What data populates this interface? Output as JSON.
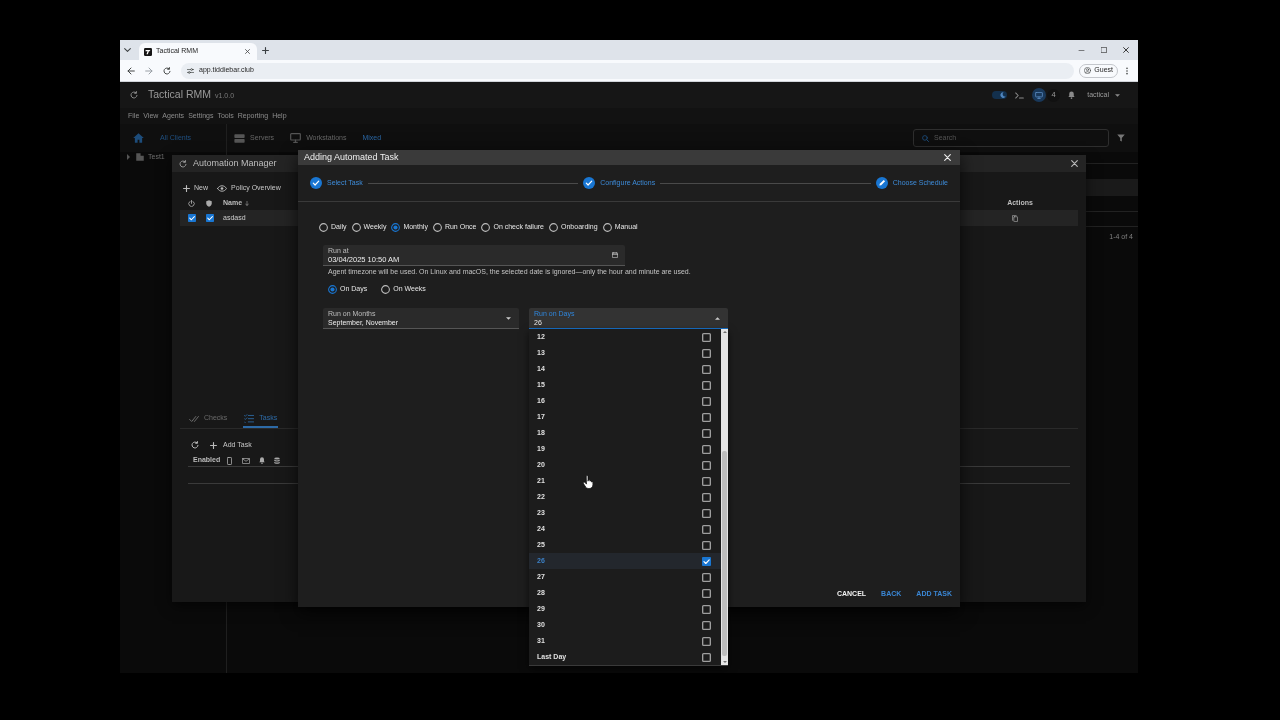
{
  "browser": {
    "tab": {
      "title": "Tactical RMM"
    },
    "url": "app.tiddiebar.club",
    "profile": "Guest"
  },
  "app": {
    "title": "Tactical RMM",
    "version": "v1.0.0",
    "theme_toggle": {
      "on": true
    },
    "agent_count": "4",
    "user": "tactical",
    "menu": [
      "File",
      "View",
      "Agents",
      "Settings",
      "Tools",
      "Reporting",
      "Help"
    ],
    "clients_tab": "All Clients",
    "agent_tabs": [
      {
        "label": "Servers",
        "kind": "server",
        "selected": false
      },
      {
        "label": "Workstations",
        "kind": "workstation",
        "selected": false
      },
      {
        "label": "Mixed",
        "kind": "mixed",
        "selected": true
      }
    ],
    "search": {
      "placeholder": "Search"
    },
    "tree": [
      {
        "label": "Test1",
        "expanded": false
      }
    ],
    "pagination": "1-4 of 4"
  },
  "automation_manager": {
    "title": "Automation Manager",
    "toolbar": [
      {
        "label": "New",
        "kind": "new"
      },
      {
        "label": "Policy Overview",
        "kind": "overview"
      }
    ],
    "columns": {
      "name": "Name",
      "actions": "Actions"
    },
    "policies": [
      {
        "enabled": true,
        "enforced": true,
        "name": "asdasd",
        "selected": true
      }
    ],
    "tabs": [
      {
        "label": "Checks",
        "kind": "checks",
        "selected": false
      },
      {
        "label": "Tasks",
        "kind": "tasks",
        "selected": true
      }
    ],
    "tasks": {
      "add_button": "Add Task",
      "enabled_column": "Enabled"
    }
  },
  "task_dialog": {
    "title": "Adding Automated Task",
    "steps": [
      {
        "label": "Select Task",
        "kind": "done"
      },
      {
        "label": "Configure Actions",
        "kind": "done"
      },
      {
        "label": "Choose Schedule",
        "kind": "edit"
      }
    ],
    "schedule_types": [
      {
        "label": "Daily",
        "selected": false
      },
      {
        "label": "Weekly",
        "selected": false
      },
      {
        "label": "Monthly",
        "selected": true
      },
      {
        "label": "Run Once",
        "selected": false
      },
      {
        "label": "On check failure",
        "selected": false
      },
      {
        "label": "Onboarding",
        "selected": false
      },
      {
        "label": "Manual",
        "selected": false
      }
    ],
    "run_at": {
      "label": "Run at",
      "value": "03/04/2025 10:50 AM",
      "hint": "Agent timezone will be used. On Linux and macOS, the selected date is ignored—only the hour and minute are used."
    },
    "day_modes": [
      {
        "label": "On Days",
        "selected": true
      },
      {
        "label": "On Weeks",
        "selected": false
      }
    ],
    "months_select": {
      "label": "Run on Months",
      "value": "September, November",
      "expanded": false
    },
    "days_select": {
      "label": "Run on Days",
      "value": "26",
      "expanded": true,
      "options": [
        {
          "label": "12",
          "checked": false,
          "selected": false
        },
        {
          "label": "13",
          "checked": false,
          "selected": false
        },
        {
          "label": "14",
          "checked": false,
          "selected": false
        },
        {
          "label": "15",
          "checked": false,
          "selected": false
        },
        {
          "label": "16",
          "checked": false,
          "selected": false
        },
        {
          "label": "17",
          "checked": false,
          "selected": false
        },
        {
          "label": "18",
          "checked": false,
          "selected": false
        },
        {
          "label": "19",
          "checked": false,
          "selected": false
        },
        {
          "label": "20",
          "checked": false,
          "selected": false
        },
        {
          "label": "21",
          "checked": false,
          "selected": false
        },
        {
          "label": "22",
          "checked": false,
          "selected": false
        },
        {
          "label": "23",
          "checked": false,
          "selected": false
        },
        {
          "label": "24",
          "checked": false,
          "selected": false
        },
        {
          "label": "25",
          "checked": false,
          "selected": false
        },
        {
          "label": "26",
          "checked": true,
          "selected": true
        },
        {
          "label": "27",
          "checked": false,
          "selected": false
        },
        {
          "label": "28",
          "checked": false,
          "selected": false
        },
        {
          "label": "29",
          "checked": false,
          "selected": false
        },
        {
          "label": "30",
          "checked": false,
          "selected": false
        },
        {
          "label": "31",
          "checked": false,
          "selected": false
        },
        {
          "label": "Last Day",
          "checked": false,
          "selected": false
        }
      ]
    },
    "buttons": [
      {
        "label": "CANCEL",
        "kind": "plain"
      },
      {
        "label": "BACK",
        "kind": "primary"
      },
      {
        "label": "ADD TASK",
        "kind": "primary"
      }
    ]
  }
}
